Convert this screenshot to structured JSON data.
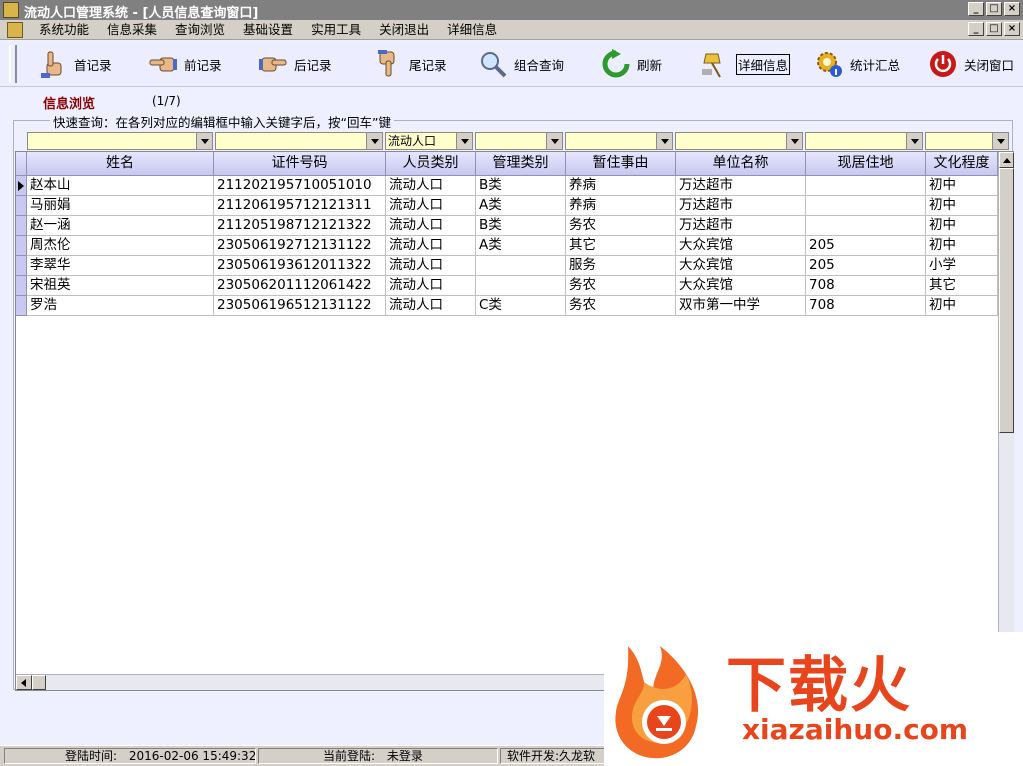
{
  "window": {
    "title": "流动人口管理系统 - [人员信息查询窗口]",
    "mdi_controls": [
      "_",
      "□",
      "×"
    ],
    "outer_controls": [
      "_",
      "□",
      "×"
    ]
  },
  "menu": [
    "系统功能",
    "信息采集",
    "查询浏览",
    "基础设置",
    "实用工具",
    "关闭退出",
    "详细信息"
  ],
  "toolbar": {
    "first": "首记录",
    "prev": "前记录",
    "next": "后记录",
    "last": "尾记录",
    "combo_query": "组合查询",
    "refresh": "刷新",
    "detail": "详细信息",
    "stats": "统计汇总",
    "close": "关闭窗口"
  },
  "browse": {
    "title": "信息浏览",
    "count": "(1/7)",
    "hint": "快速查询：在各列对应的编辑框中输入关键字后，按“回车”键"
  },
  "filters": [
    "",
    "",
    "流动人口",
    "",
    "",
    "",
    "",
    ""
  ],
  "columns": [
    "姓名",
    "证件号码",
    "人员类别",
    "管理类别",
    "暂住事由",
    "单位名称",
    "现居住地",
    "文化程度"
  ],
  "rows": [
    [
      "赵本山",
      "211202195710051010",
      "流动人口",
      "B类",
      "养病",
      "万达超市",
      "",
      "初中"
    ],
    [
      "马丽娟",
      "211206195712121311",
      "流动人口",
      "A类",
      "养病",
      "万达超市",
      "",
      "初中"
    ],
    [
      "赵一涵",
      "211205198712121322",
      "流动人口",
      "B类",
      "务农",
      "万达超市",
      "",
      "初中"
    ],
    [
      "周杰伦",
      "230506192712131122",
      "流动人口",
      "A类",
      "其它",
      "大众宾馆",
      "205",
      "初中"
    ],
    [
      "李翠华",
      "230506193612011322",
      "流动人口",
      "",
      "服务",
      "大众宾馆",
      "205",
      "小学"
    ],
    [
      "宋祖英",
      "230506201112061422",
      "流动人口",
      "",
      "务农",
      "大众宾馆",
      "708",
      "其它"
    ],
    [
      "罗浩",
      "230506196512131122",
      "流动人口",
      "C类",
      "务农",
      "双市第一中学",
      "708",
      "初中"
    ]
  ],
  "status": {
    "login_time_label": "登陆时间:",
    "login_time": "2016-02-06 15:49:32",
    "current_user_label": "当前登陆:",
    "current_user": "未登录",
    "dev_label": "软件开发:久龙软"
  },
  "watermark": {
    "brand": "下载火",
    "url": "xiazaihuo.com"
  },
  "colors": {
    "background": "#eef0ff",
    "filter_bg": "#ffffcc",
    "section_title": "#8b0000",
    "watermark": "#e8451c"
  }
}
